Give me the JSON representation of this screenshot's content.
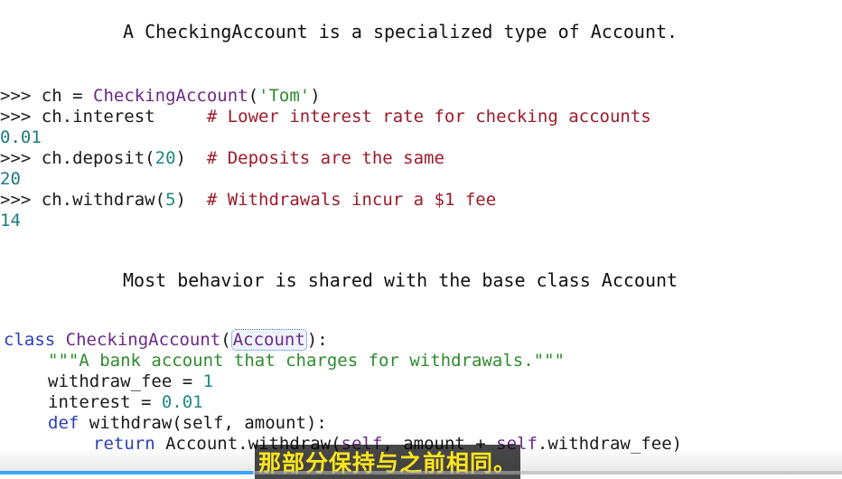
{
  "heading1": "A CheckingAccount is a specialized type of Account.",
  "repl": {
    "prompt": ">>>",
    "l1_var": "ch",
    "l1_eq": " = ",
    "l1_class": "CheckingAccount",
    "l1_open": "(",
    "l1_str": "'Tom'",
    "l1_close": ")",
    "l2_code": "ch.interest",
    "l2_comment": "# Lower interest rate for checking accounts",
    "out1": "0.01",
    "l3_code": "ch.deposit",
    "l3_num": "20",
    "l3_comment": "# Deposits are the same",
    "out2": "20",
    "l4_code": "ch.withdraw",
    "l4_num": "5",
    "l4_comment": "# Withdrawals incur a $1 fee",
    "out3": "14"
  },
  "heading2": "Most behavior is shared with the base class Account",
  "code": {
    "kw_class": "class",
    "class_name": "CheckingAccount",
    "base": "Account",
    "colon": "):",
    "docstring": "\"\"\"A bank account that charges for withdrawals.\"\"\"",
    "fee_name": "withdraw_fee",
    "fee_eq": " = ",
    "fee_val": "1",
    "int_name": "interest",
    "int_eq": " = ",
    "int_val": "0.01",
    "kw_def": "def",
    "def_rest": " withdraw(self, amount):",
    "kw_return": "return",
    "ret_a": " Account.withdraw(",
    "ret_self1": "self",
    "ret_b": ", amount + ",
    "ret_self2": "self",
    "ret_c": ".withdraw_fee)"
  },
  "subtitle": "那部分保持与之前相同。",
  "progress": 0.3
}
